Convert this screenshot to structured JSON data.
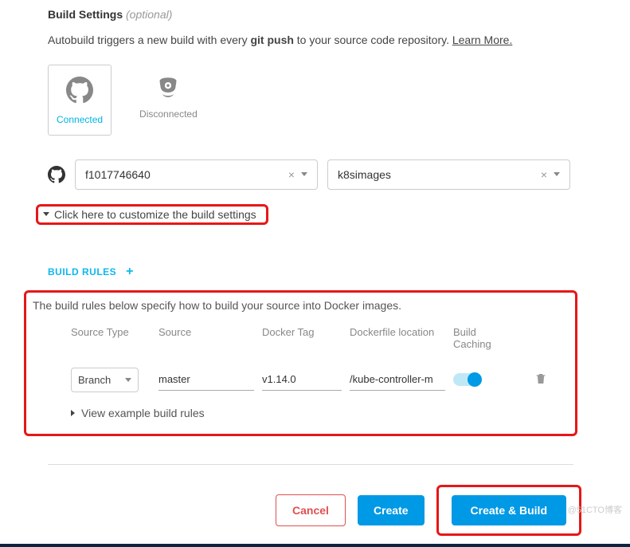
{
  "header": {
    "title": "Build Settings",
    "optional": "(optional)"
  },
  "description": {
    "before": "Autobuild triggers a new build with every ",
    "bold": "git push",
    "after": " to your source code repository. ",
    "link": "Learn More."
  },
  "providers": {
    "github": {
      "label": "Connected"
    },
    "bitbucket": {
      "label": "Disconnected"
    }
  },
  "selects": {
    "org": "f1017746640",
    "repo": "k8simages"
  },
  "customize": {
    "label": "Click here to customize the build settings"
  },
  "rules": {
    "title": "BUILD RULES",
    "desc": "The build rules below specify how to build your source into Docker images.",
    "columns": {
      "source_type": "Source Type",
      "source": "Source",
      "docker_tag": "Docker Tag",
      "dockerfile": "Dockerfile location",
      "caching": "Build Caching"
    },
    "row": {
      "source_type": "Branch",
      "source": "master",
      "docker_tag": "v1.14.0",
      "dockerfile": "/kube-controller-m"
    },
    "example": "View example build rules"
  },
  "actions": {
    "cancel": "Cancel",
    "create": "Create",
    "create_build": "Create & Build"
  },
  "watermark": "@51CTO博客"
}
